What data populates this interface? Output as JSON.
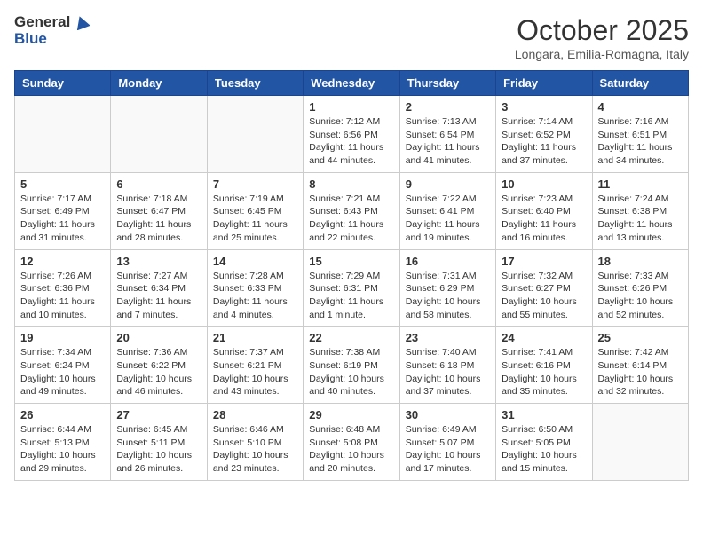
{
  "logo": {
    "general": "General",
    "blue": "Blue"
  },
  "header": {
    "month": "October 2025",
    "location": "Longara, Emilia-Romagna, Italy"
  },
  "weekdays": [
    "Sunday",
    "Monday",
    "Tuesday",
    "Wednesday",
    "Thursday",
    "Friday",
    "Saturday"
  ],
  "weeks": [
    [
      {
        "day": "",
        "info": ""
      },
      {
        "day": "",
        "info": ""
      },
      {
        "day": "",
        "info": ""
      },
      {
        "day": "1",
        "info": "Sunrise: 7:12 AM\nSunset: 6:56 PM\nDaylight: 11 hours and 44 minutes."
      },
      {
        "day": "2",
        "info": "Sunrise: 7:13 AM\nSunset: 6:54 PM\nDaylight: 11 hours and 41 minutes."
      },
      {
        "day": "3",
        "info": "Sunrise: 7:14 AM\nSunset: 6:52 PM\nDaylight: 11 hours and 37 minutes."
      },
      {
        "day": "4",
        "info": "Sunrise: 7:16 AM\nSunset: 6:51 PM\nDaylight: 11 hours and 34 minutes."
      }
    ],
    [
      {
        "day": "5",
        "info": "Sunrise: 7:17 AM\nSunset: 6:49 PM\nDaylight: 11 hours and 31 minutes."
      },
      {
        "day": "6",
        "info": "Sunrise: 7:18 AM\nSunset: 6:47 PM\nDaylight: 11 hours and 28 minutes."
      },
      {
        "day": "7",
        "info": "Sunrise: 7:19 AM\nSunset: 6:45 PM\nDaylight: 11 hours and 25 minutes."
      },
      {
        "day": "8",
        "info": "Sunrise: 7:21 AM\nSunset: 6:43 PM\nDaylight: 11 hours and 22 minutes."
      },
      {
        "day": "9",
        "info": "Sunrise: 7:22 AM\nSunset: 6:41 PM\nDaylight: 11 hours and 19 minutes."
      },
      {
        "day": "10",
        "info": "Sunrise: 7:23 AM\nSunset: 6:40 PM\nDaylight: 11 hours and 16 minutes."
      },
      {
        "day": "11",
        "info": "Sunrise: 7:24 AM\nSunset: 6:38 PM\nDaylight: 11 hours and 13 minutes."
      }
    ],
    [
      {
        "day": "12",
        "info": "Sunrise: 7:26 AM\nSunset: 6:36 PM\nDaylight: 11 hours and 10 minutes."
      },
      {
        "day": "13",
        "info": "Sunrise: 7:27 AM\nSunset: 6:34 PM\nDaylight: 11 hours and 7 minutes."
      },
      {
        "day": "14",
        "info": "Sunrise: 7:28 AM\nSunset: 6:33 PM\nDaylight: 11 hours and 4 minutes."
      },
      {
        "day": "15",
        "info": "Sunrise: 7:29 AM\nSunset: 6:31 PM\nDaylight: 11 hours and 1 minute."
      },
      {
        "day": "16",
        "info": "Sunrise: 7:31 AM\nSunset: 6:29 PM\nDaylight: 10 hours and 58 minutes."
      },
      {
        "day": "17",
        "info": "Sunrise: 7:32 AM\nSunset: 6:27 PM\nDaylight: 10 hours and 55 minutes."
      },
      {
        "day": "18",
        "info": "Sunrise: 7:33 AM\nSunset: 6:26 PM\nDaylight: 10 hours and 52 minutes."
      }
    ],
    [
      {
        "day": "19",
        "info": "Sunrise: 7:34 AM\nSunset: 6:24 PM\nDaylight: 10 hours and 49 minutes."
      },
      {
        "day": "20",
        "info": "Sunrise: 7:36 AM\nSunset: 6:22 PM\nDaylight: 10 hours and 46 minutes."
      },
      {
        "day": "21",
        "info": "Sunrise: 7:37 AM\nSunset: 6:21 PM\nDaylight: 10 hours and 43 minutes."
      },
      {
        "day": "22",
        "info": "Sunrise: 7:38 AM\nSunset: 6:19 PM\nDaylight: 10 hours and 40 minutes."
      },
      {
        "day": "23",
        "info": "Sunrise: 7:40 AM\nSunset: 6:18 PM\nDaylight: 10 hours and 37 minutes."
      },
      {
        "day": "24",
        "info": "Sunrise: 7:41 AM\nSunset: 6:16 PM\nDaylight: 10 hours and 35 minutes."
      },
      {
        "day": "25",
        "info": "Sunrise: 7:42 AM\nSunset: 6:14 PM\nDaylight: 10 hours and 32 minutes."
      }
    ],
    [
      {
        "day": "26",
        "info": "Sunrise: 6:44 AM\nSunset: 5:13 PM\nDaylight: 10 hours and 29 minutes."
      },
      {
        "day": "27",
        "info": "Sunrise: 6:45 AM\nSunset: 5:11 PM\nDaylight: 10 hours and 26 minutes."
      },
      {
        "day": "28",
        "info": "Sunrise: 6:46 AM\nSunset: 5:10 PM\nDaylight: 10 hours and 23 minutes."
      },
      {
        "day": "29",
        "info": "Sunrise: 6:48 AM\nSunset: 5:08 PM\nDaylight: 10 hours and 20 minutes."
      },
      {
        "day": "30",
        "info": "Sunrise: 6:49 AM\nSunset: 5:07 PM\nDaylight: 10 hours and 17 minutes."
      },
      {
        "day": "31",
        "info": "Sunrise: 6:50 AM\nSunset: 5:05 PM\nDaylight: 10 hours and 15 minutes."
      },
      {
        "day": "",
        "info": ""
      }
    ]
  ]
}
